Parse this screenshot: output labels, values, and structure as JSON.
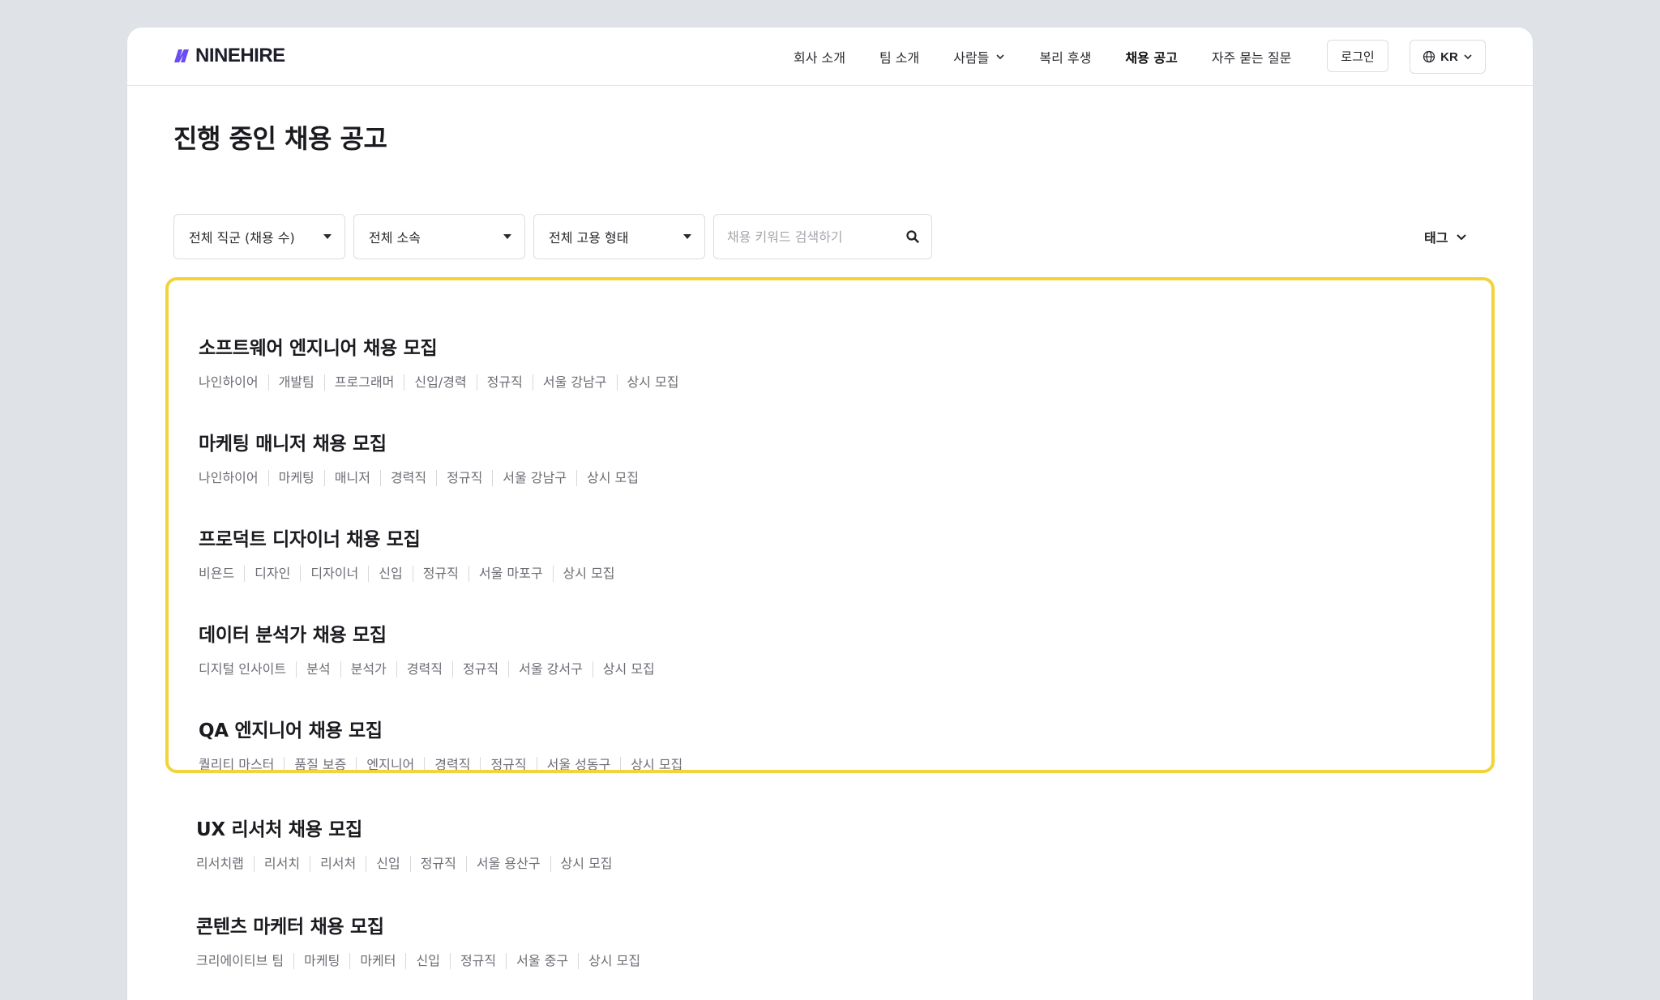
{
  "header": {
    "logo_text": "NINEHIRE",
    "nav": [
      {
        "label": "회사 소개",
        "name": "nav-company",
        "active": false,
        "dropdown": false
      },
      {
        "label": "팀 소개",
        "name": "nav-team",
        "active": false,
        "dropdown": false
      },
      {
        "label": "사람들",
        "name": "nav-people",
        "active": false,
        "dropdown": true
      },
      {
        "label": "복리 후생",
        "name": "nav-benefits",
        "active": false,
        "dropdown": false
      },
      {
        "label": "채용 공고",
        "name": "nav-jobs",
        "active": true,
        "dropdown": false
      },
      {
        "label": "자주 묻는 질문",
        "name": "nav-faq",
        "active": false,
        "dropdown": false
      }
    ],
    "login_label": "로그인",
    "lang_label": "KR"
  },
  "main": {
    "title": "진행 중인 채용 공고",
    "filters": {
      "job_group": "전체 직군 (채용 수)",
      "affiliation": "전체 소속",
      "employment_type": "전체 고용 형태",
      "search_placeholder": "채용 키워드 검색하기",
      "search_value": "",
      "tag_label": "태그"
    },
    "jobs": [
      {
        "title": "소프트웨어 엔지니어 채용 모집",
        "tags": [
          "나인하이어",
          "개발팀",
          "프로그래머",
          "신입/경력",
          "정규직",
          "서울 강남구",
          "상시 모집"
        ]
      },
      {
        "title": "마케팅 매니저 채용 모집",
        "tags": [
          "나인하이어",
          "마케팅",
          "매니저",
          "경력직",
          "정규직",
          "서울 강남구",
          "상시 모집"
        ]
      },
      {
        "title": "프로덕트 디자이너 채용 모집",
        "tags": [
          "비욘드",
          "디자인",
          "디자이너",
          "신입",
          "정규직",
          "서울 마포구",
          "상시 모집"
        ]
      },
      {
        "title": "데이터 분석가 채용 모집",
        "tags": [
          "디지털 인사이트",
          "분석",
          "분석가",
          "경력직",
          "정규직",
          "서울 강서구",
          "상시 모집"
        ]
      },
      {
        "title": "QA 엔지니어 채용 모집",
        "tags": [
          "퀄리티 마스터",
          "품질 보증",
          "엔지니어",
          "경력직",
          "정규직",
          "서울 성동구",
          "상시 모집"
        ]
      },
      {
        "title": "UX 리서처 채용 모집",
        "tags": [
          "리서치랩",
          "리서치",
          "리서처",
          "신입",
          "정규직",
          "서울 용산구",
          "상시 모집"
        ]
      },
      {
        "title": "콘텐츠 마케터 채용 모집",
        "tags": [
          "크리에이티브 팀",
          "마케팅",
          "마케터",
          "신입",
          "정규직",
          "서울 중구",
          "상시 모집"
        ]
      }
    ]
  },
  "colors": {
    "brand": "#6a4cf0",
    "highlight": "#f2d33a",
    "background": "#dfe2e7"
  },
  "icons": {
    "logo": "ninehire-logo-mark",
    "dropdown": "chevron-down-icon",
    "language": "globe-icon",
    "search": "search-icon",
    "select": "caret-down-icon"
  }
}
